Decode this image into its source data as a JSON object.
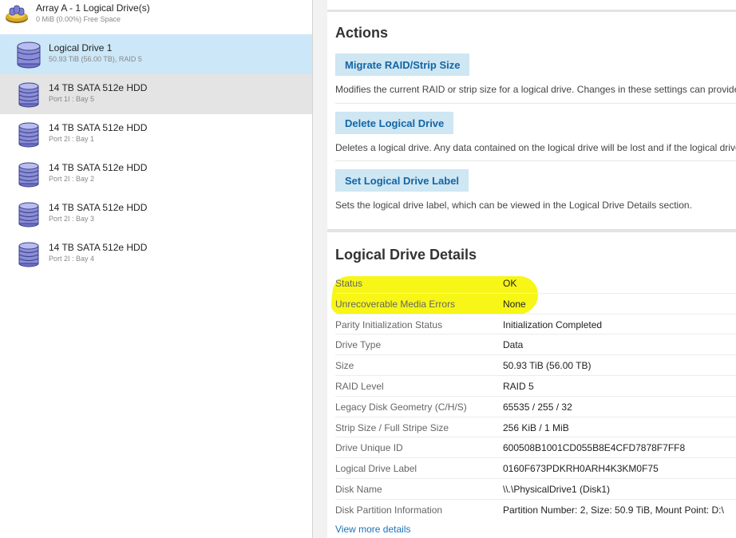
{
  "tree": {
    "array": {
      "title": "Array A - 1 Logical Drive(s)",
      "subtitle": "0 MiB (0.00%) Free Space",
      "icon": "array-drives-icon"
    },
    "logical_drive": {
      "title": "Logical Drive 1",
      "subtitle": "50.93 TiB (56.00 TB), RAID 5",
      "icon": "logical-drive-icon"
    },
    "physical_drives": [
      {
        "title": "14 TB SATA 512e HDD",
        "subtitle": "Port 1I : Bay 5"
      },
      {
        "title": "14 TB SATA 512e HDD",
        "subtitle": "Port 2I : Bay 1"
      },
      {
        "title": "14 TB SATA 512e HDD",
        "subtitle": "Port 2I : Bay 2"
      },
      {
        "title": "14 TB SATA 512e HDD",
        "subtitle": "Port 2I : Bay 3"
      },
      {
        "title": "14 TB SATA 512e HDD",
        "subtitle": "Port 2I : Bay 4"
      }
    ]
  },
  "actions": {
    "heading": "Actions",
    "items": [
      {
        "label": "Migrate RAID/Strip Size",
        "description": "Modifies the current RAID or strip size for a logical drive. Changes in these settings can provide"
      },
      {
        "label": "Delete Logical Drive",
        "description": "Deletes a logical drive. Any data contained on the logical drive will be lost and if the logical drive"
      },
      {
        "label": "Set Logical Drive Label",
        "description": "Sets the logical drive label, which can be viewed in the Logical Drive Details section."
      }
    ]
  },
  "details": {
    "heading": "Logical Drive Details",
    "rows": [
      {
        "key": "Status",
        "value": "OK"
      },
      {
        "key": "Unrecoverable Media Errors",
        "value": "None"
      },
      {
        "key": "Parity Initialization Status",
        "value": "Initialization Completed"
      },
      {
        "key": "Drive Type",
        "value": "Data"
      },
      {
        "key": "Size",
        "value": "50.93 TiB (56.00 TB)"
      },
      {
        "key": "RAID Level",
        "value": "RAID 5"
      },
      {
        "key": "Legacy Disk Geometry (C/H/S)",
        "value": "65535 / 255 / 32"
      },
      {
        "key": "Strip Size / Full Stripe Size",
        "value": "256 KiB / 1 MiB"
      },
      {
        "key": "Drive Unique ID",
        "value": "600508B1001CD055B8E4CFD7878F7FF8"
      },
      {
        "key": "Logical Drive Label",
        "value": "0160F673PDKRH0ARH4K3KM0F75"
      },
      {
        "key": "Disk Name",
        "value": "\\\\.\\PhysicalDrive1 (Disk1)"
      },
      {
        "key": "Disk Partition Information",
        "value": "Partition Number: 2, Size: 50.9 TiB, Mount Point: D:\\"
      }
    ],
    "view_more": "View more details"
  },
  "colors": {
    "selected_bg": "#cce7f7",
    "hover_bg": "#e4e4e4",
    "button_bg": "#cfe6f3",
    "button_text": "#1266a6",
    "link": "#1a73b8",
    "highlight": "#f7f50a"
  }
}
